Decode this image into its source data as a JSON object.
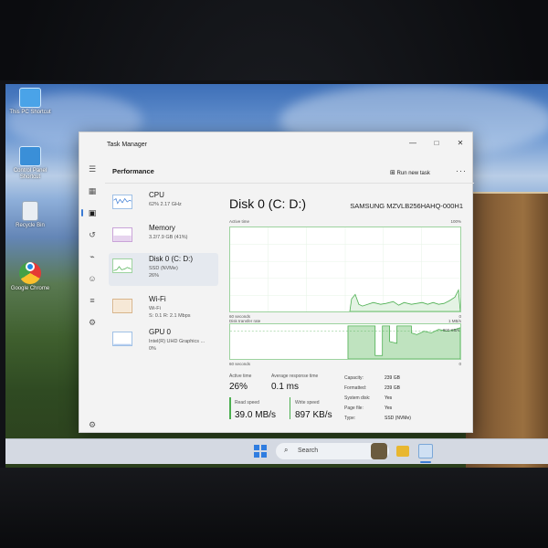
{
  "desktop": {
    "icons": [
      {
        "label": "This PC Shortcut",
        "icon": "this-pc-icon"
      },
      {
        "label": "Control Panel Shortcut",
        "icon": "control-panel-icon"
      },
      {
        "label": "Recycle Bin",
        "icon": "recycle-bin-icon"
      },
      {
        "label": "Google Chrome",
        "icon": "chrome-icon"
      }
    ]
  },
  "window": {
    "title": "Task Manager",
    "controls": {
      "minimize": "—",
      "maximize": "□",
      "close": "✕"
    }
  },
  "toolbar": {
    "section_title": "Performance",
    "run_new_task": "Run new task",
    "more": "···"
  },
  "resources": [
    {
      "name": "CPU",
      "line1": "62% 2.17 GHz",
      "line2": ""
    },
    {
      "name": "Memory",
      "line1": "3.2/7.9 GB (41%)",
      "line2": ""
    },
    {
      "name": "Disk 0 (C: D:)",
      "line1": "SSD (NVMe)",
      "line2": "26%"
    },
    {
      "name": "Wi-Fi",
      "line1": "Wi-Fi",
      "line2": "S: 0.1 R: 2.1 Mbps"
    },
    {
      "name": "GPU 0",
      "line1": "Intel(R) UHD Graphics ...",
      "line2": "0%"
    }
  ],
  "detail": {
    "title": "Disk 0 (C: D:)",
    "model": "SAMSUNG MZVLB256HAHQ-000H1",
    "graph1": {
      "label": "Active time",
      "max": "100%",
      "duration": "60 seconds",
      "min": "0"
    },
    "graph2": {
      "label": "Disk transfer rate",
      "max": "1 MB/s",
      "marker": "800 KB/s",
      "duration": "60 seconds",
      "min": "0"
    },
    "stats": {
      "active_time_label": "Active time",
      "active_time": "26%",
      "avg_response_label": "Average response time",
      "avg_response": "0.1 ms",
      "read_speed_label": "Read speed",
      "read_speed": "39.0 MB/s",
      "write_speed_label": "Write speed",
      "write_speed": "897 KB/s"
    },
    "props": [
      {
        "k": "Capacity:",
        "v": "239 GB"
      },
      {
        "k": "Formatted:",
        "v": "239 GB"
      },
      {
        "k": "System disk:",
        "v": "Yes"
      },
      {
        "k": "Page file:",
        "v": "Yes"
      },
      {
        "k": "Type:",
        "v": "SSD (NVMe)"
      }
    ]
  },
  "taskbar": {
    "search_placeholder": "Search"
  },
  "colors": {
    "accent": "#3b7bd4",
    "disk_graph": "#4caf50",
    "window_bg": "#f3f3f3"
  }
}
